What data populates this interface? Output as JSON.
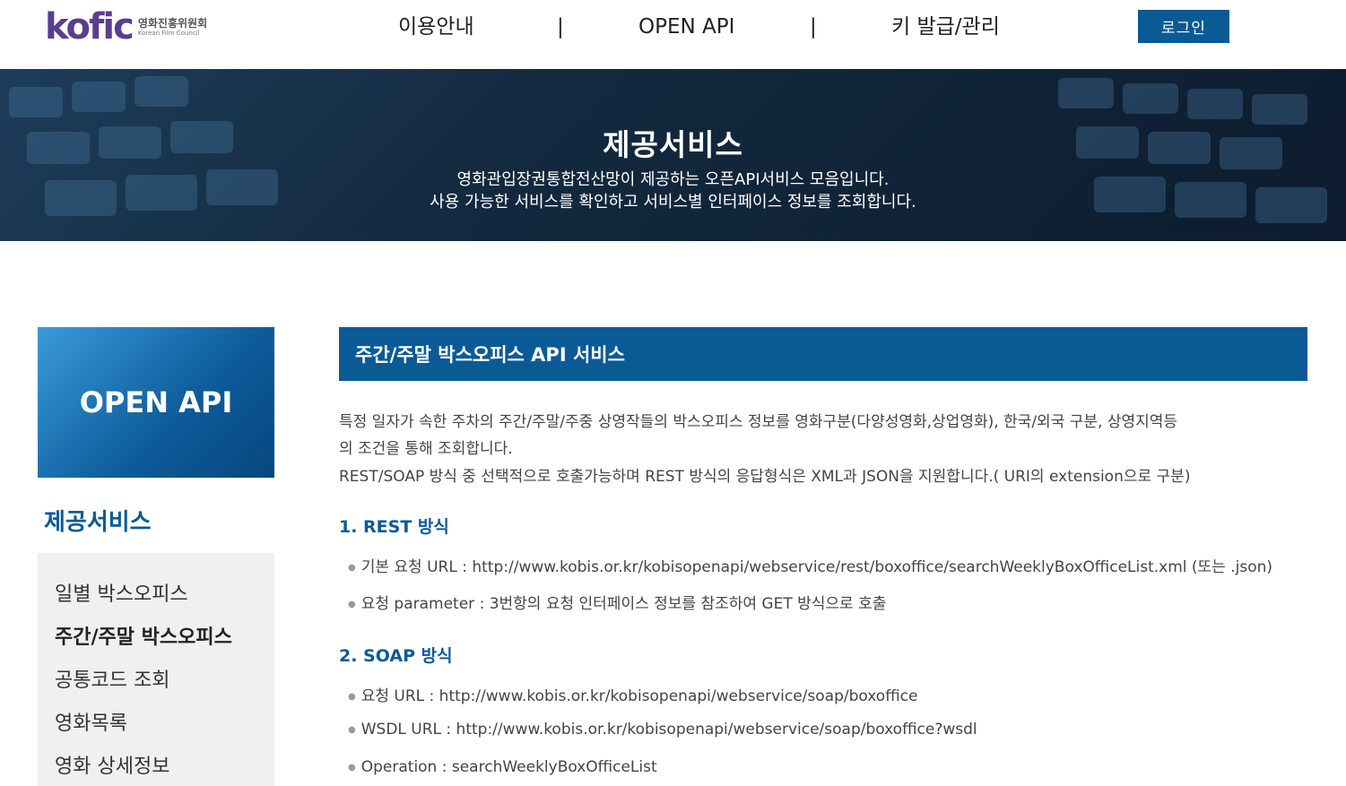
{
  "logo": {
    "brand": "kofic",
    "name_ko": "영화진흥위원회",
    "name_en": "Korean Film Council"
  },
  "nav": {
    "items": [
      "이용안내",
      "OPEN API",
      "키 발급/관리"
    ],
    "separator": "|"
  },
  "login_label": "로그인",
  "banner": {
    "title": "제공서비스",
    "line1": "영화관입장권통합전산망이 제공하는 오픈API서비스 모음입니다.",
    "line2": "사용 가능한 서비스를 확인하고 서비스별 인터페이스 정보를 조회합니다."
  },
  "sidebar": {
    "box_title": "OPEN API",
    "heading": "제공서비스",
    "items": [
      {
        "label": "일별 박스오피스"
      },
      {
        "label": "주간/주말 박스오피스"
      },
      {
        "label": "공통코드 조회"
      },
      {
        "label": "영화목록"
      },
      {
        "label": "영화 상세정보"
      }
    ],
    "active_index": 1
  },
  "content": {
    "title": "주간/주말 박스오피스 API 서비스",
    "desc_line1": "특정 일자가 속한 주차의 주간/주말/주중 상영작들의 박스오피스 정보를 영화구분(다양성영화,상업영화), 한국/외국 구분, 상영지역등",
    "desc_line2": "의 조건을 통해 조회합니다.",
    "desc_line3": "REST/SOAP 방식 중 선택적으로 호출가능하며 REST 방식의 응답형식은 XML과 JSON을 지원합니다.( URI의 extension으로 구분)",
    "section1": {
      "title": "1. REST 방식",
      "bullets": [
        "기본 요청 URL : http://www.kobis.or.kr/kobisopenapi/webservice/rest/boxoffice/searchWeeklyBoxOfficeList.xml (또는 .json)",
        "요청 parameter : 3번항의 요청 인터페이스 정보를 참조하여 GET 방식으로 호출"
      ]
    },
    "section2": {
      "title": "2. SOAP 방식",
      "bullets": [
        "요청 URL : http://www.kobis.or.kr/kobisopenapi/webservice/soap/boxoffice",
        "WSDL URL : http://www.kobis.or.kr/kobisopenapi/webservice/soap/boxoffice?wsdl",
        "Operation : searchWeeklyBoxOfficeList"
      ]
    }
  },
  "colors": {
    "primary": "#0a5a96",
    "accent": "#0c5a96",
    "menu_bg": "#f0f0f0",
    "logo_purple": "#5b3d8f",
    "logo_red": "#e2325b"
  }
}
